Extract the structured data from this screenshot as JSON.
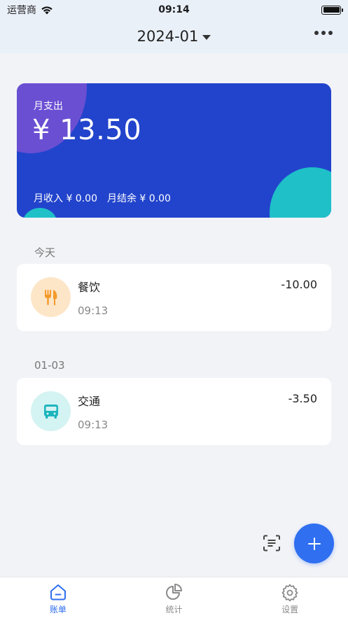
{
  "status_bar": {
    "carrier": "运营商",
    "time": "09:14"
  },
  "nav": {
    "title": "2024-01"
  },
  "summary": {
    "label": "月支出",
    "amount": "¥ 13.50",
    "income": "月收入 ¥ 0.00",
    "balance": "月结余 ¥ 0.00"
  },
  "colors": {
    "accent": "#2f6ff0",
    "card_bg": "#2244cc",
    "teal": "#1fc0c8",
    "food_bg": "#fde6c8",
    "food_icon": "#f39a2a",
    "transport_bg": "#d4f3f3",
    "transport_icon": "#1cb5bd"
  },
  "groups": [
    {
      "date": "今天",
      "items": [
        {
          "icon": "utensils-icon",
          "category": "餐饮",
          "time": "09:13",
          "amount": "-10.00"
        }
      ]
    },
    {
      "date": "01-03",
      "items": [
        {
          "icon": "bus-icon",
          "category": "交通",
          "time": "09:13",
          "amount": "-3.50"
        }
      ]
    }
  ],
  "tabs": [
    {
      "label": "账单",
      "icon": "home-icon"
    },
    {
      "label": "统计",
      "icon": "pie-chart-icon"
    },
    {
      "label": "设置",
      "icon": "gear-icon"
    }
  ]
}
